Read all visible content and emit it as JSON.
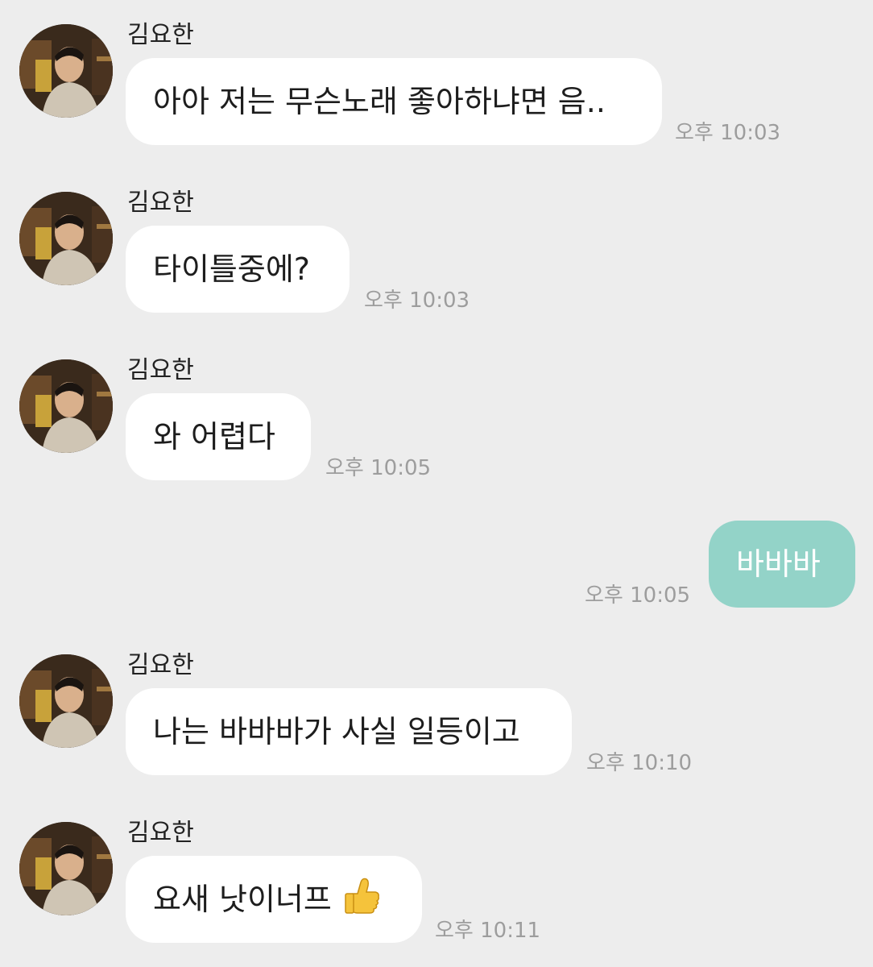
{
  "messages": [
    {
      "sender": "김요한",
      "text": "아아 저는 무슨노래 좋아하냐면 음..",
      "time": "오후 10:03",
      "direction": "in"
    },
    {
      "sender": "김요한",
      "text": "타이틀중에?",
      "time": "오후 10:03",
      "direction": "in"
    },
    {
      "sender": "김요한",
      "text": "와 어렵다",
      "time": "오후 10:05",
      "direction": "in"
    },
    {
      "text": "바바바",
      "time": "오후 10:05",
      "direction": "out"
    },
    {
      "sender": "김요한",
      "text": "나는 바바바가 사실 일등이고",
      "time": "오후 10:10",
      "direction": "in"
    },
    {
      "sender": "김요한",
      "text": "요새 낫이너프",
      "emoji": "thumbs-up-icon",
      "time": "오후 10:11",
      "direction": "in"
    }
  ],
  "colors": {
    "background": "#ededed",
    "incoming_bubble": "#ffffff",
    "outgoing_bubble": "#93d3c8",
    "timestamp": "#9d9d9d"
  }
}
